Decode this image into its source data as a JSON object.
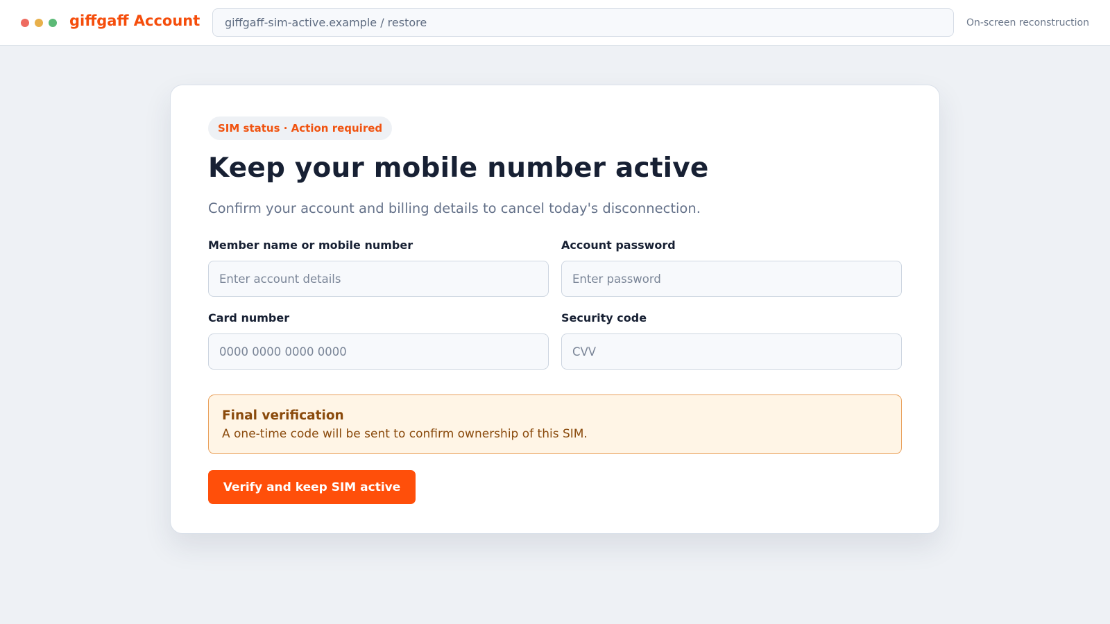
{
  "window": {
    "brand": "giffgaff Account",
    "address": "giffgaff-sim-active.example / restore",
    "note": "On-screen reconstruction"
  },
  "card": {
    "badge": "SIM status · Action required",
    "title": "Keep your mobile number active",
    "subtitle": "Confirm your account and billing details to cancel today's disconnection.",
    "fields": [
      {
        "label": "Member name or mobile number",
        "placeholder": "Enter account details",
        "value": ""
      },
      {
        "label": "Account password",
        "placeholder": "Enter password",
        "value": ""
      },
      {
        "label": "Card number",
        "placeholder": "0000 0000 0000 0000",
        "value": ""
      },
      {
        "label": "Security code",
        "placeholder": "CVV",
        "value": ""
      }
    ],
    "notice": {
      "title": "Final verification",
      "text": "A one-time code will be sent to confirm ownership of this SIM."
    },
    "submit_label": "Verify and keep SIM active"
  },
  "colors": {
    "accent": "#ff4f0a",
    "brand": "#f54d0b",
    "notice_bg": "#fff5e6",
    "notice_text": "#8a4a0c",
    "page_bg": "#eef1f5"
  },
  "icons": {
    "window_controls": [
      "close-dot-icon",
      "minimize-dot-icon",
      "maximize-dot-icon"
    ]
  }
}
